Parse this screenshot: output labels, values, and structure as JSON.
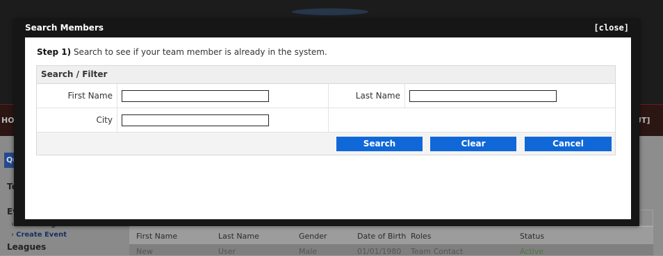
{
  "background": {
    "nav_left": "HOM",
    "nav_right": "UT]",
    "sidebar": {
      "tab": "Qu",
      "heading_teams": "Tea",
      "heading_events": "Eve",
      "link_event_registration": "Event Registration",
      "link_create_event": "Create Event",
      "heading_leagues": "Leagues"
    },
    "table": {
      "headers": [
        "First Name",
        "Last Name",
        "Gender",
        "Date of Birth",
        "Roles",
        "Status"
      ],
      "row": [
        "New",
        "User",
        "Male",
        "01/01/1980",
        "Team Contact",
        "Active"
      ]
    }
  },
  "dialog": {
    "title": "Search Members",
    "close_label": "[close]",
    "step_prefix": "Step 1)",
    "step_text": " Search to see if your team member is already in the system.",
    "filter": {
      "header": "Search / Filter",
      "first_name_label": "First Name",
      "first_name_value": "",
      "last_name_label": "Last Name",
      "last_name_value": "",
      "city_label": "City",
      "city_value": ""
    },
    "buttons": {
      "search": "Search",
      "clear": "Clear",
      "cancel": "Cancel"
    }
  },
  "colors": {
    "button_blue": "#1068d8",
    "dialog_frame": "#161616"
  }
}
